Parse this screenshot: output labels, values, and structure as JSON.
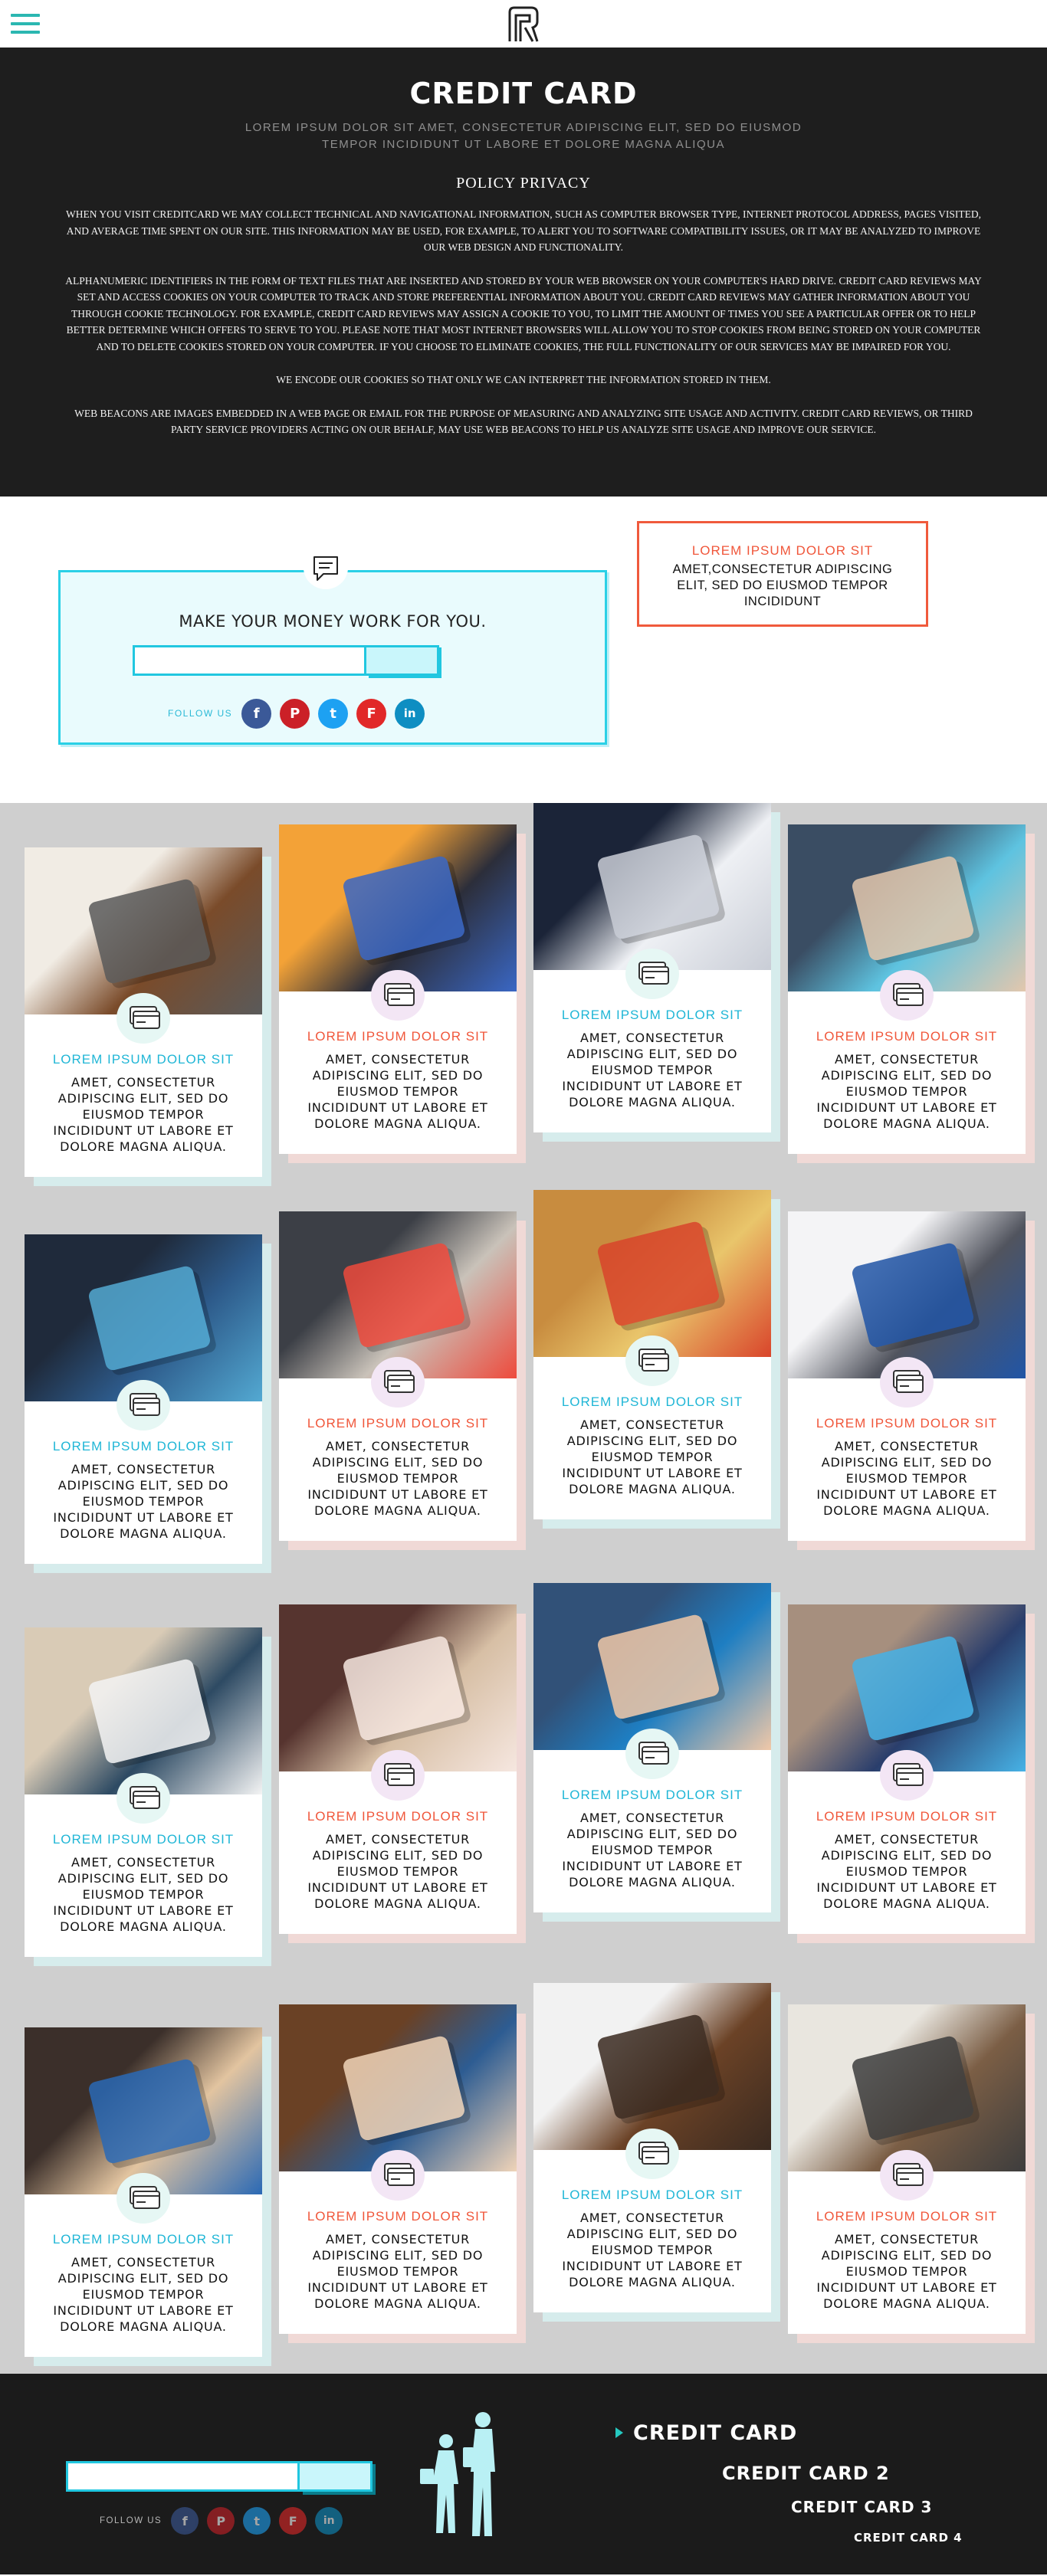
{
  "header": {
    "menu_icon": "hamburger-menu-icon",
    "logo_icon": "brand-logo-icon",
    "accent": "#2bb7b1"
  },
  "hero": {
    "title": "CREDIT CARD",
    "subtitle": "LOREM IPSUM DOLOR SIT AMET, CONSECTETUR ADIPISCING ELIT, SED DO EIUSMOD TEMPOR INCIDIDUNT UT LABORE ET DOLORE MAGNA ALIQUA",
    "policy_title": "POLICY PRIVACY",
    "paragraphs": [
      "WHEN YOU VISIT CREDITCARD WE MAY COLLECT TECHNICAL AND NAVIGATIONAL INFORMATION, SUCH AS COMPUTER BROWSER TYPE, INTERNET PROTOCOL ADDRESS, PAGES VISITED, AND AVERAGE TIME SPENT ON OUR SITE. THIS INFORMATION MAY BE USED, FOR EXAMPLE, TO ALERT YOU TO SOFTWARE COMPATIBILITY ISSUES, OR IT MAY BE ANALYZED TO IMPROVE OUR WEB DESIGN AND FUNCTIONALITY.",
      "ALPHANUMERIC IDENTIFIERS IN THE FORM OF TEXT FILES THAT ARE INSERTED AND STORED BY YOUR WEB BROWSER ON YOUR COMPUTER'S HARD DRIVE. CREDIT CARD REVIEWS MAY SET AND ACCESS COOKIES ON YOUR COMPUTER TO TRACK AND STORE PREFERENTIAL INFORMATION ABOUT YOU. CREDIT CARD REVIEWS MAY GATHER INFORMATION ABOUT YOU THROUGH COOKIE TECHNOLOGY. FOR EXAMPLE, CREDIT CARD REVIEWS MAY ASSIGN A COOKIE TO YOU, TO LIMIT THE AMOUNT OF TIMES YOU SEE A PARTICULAR OFFER OR TO HELP BETTER DETERMINE WHICH OFFERS TO SERVE TO YOU. PLEASE NOTE THAT MOST INTERNET BROWSERS WILL ALLOW YOU TO STOP COOKIES FROM BEING STORED ON YOUR COMPUTER AND TO DELETE COOKIES STORED ON YOUR COMPUTER. IF YOU CHOOSE TO ELIMINATE COOKIES, THE FULL FUNCTIONALITY OF OUR SERVICES MAY BE IMPAIRED FOR YOU.",
      "WE ENCODE OUR COOKIES SO THAT ONLY WE CAN INTERPRET THE INFORMATION STORED IN THEM.",
      "WEB BEACONS ARE IMAGES EMBEDDED IN A WEB PAGE OR EMAIL FOR THE PURPOSE OF MEASURING AND ANALYZING SITE USAGE AND ACTIVITY. CREDIT CARD REVIEWS, OR THIRD PARTY SERVICE PROVIDERS ACTING ON OUR BEHALF, MAY USE WEB BEACONS TO HELP US ANALYZE SITE USAGE AND IMPROVE OUR SERVICE."
    ]
  },
  "subscribe": {
    "icon": "chat-bubble-icon",
    "heading": "MAKE YOUR MONEY WORK FOR YOU.",
    "input_value": "",
    "button_label": "",
    "follow_label": "FOLLOW US",
    "social": [
      {
        "icon": "facebook-icon",
        "glyph": "f",
        "color": "#3b5998"
      },
      {
        "icon": "pinterest-icon",
        "glyph": "P",
        "color": "#cb2027"
      },
      {
        "icon": "twitter-icon",
        "glyph": "t",
        "color": "#1da1f2"
      },
      {
        "icon": "flipboard-icon",
        "glyph": "F",
        "color": "#e12828"
      },
      {
        "icon": "linkedin-icon",
        "glyph": "in",
        "color": "#0e8ec2"
      }
    ]
  },
  "note": {
    "title": "LOREM IPSUM DOLOR SIT",
    "body": "AMET,CONSECTETUR ADIPISCING ELIT, SED DO EIUSMOD TEMPOR INCIDIDUNT",
    "accent": "#f05a3c"
  },
  "cards": [
    {
      "photo": "wallet-in-clamp-photo",
      "title": "LOREM IPSUM DOLOR SIT",
      "text": "AMET, CONSECTETUR ADIPISCING ELIT, SED DO EIUSMOD TEMPOR INCIDIDUNT UT LABORE ET DOLORE MAGNA ALIQUA.",
      "theme": "teal"
    },
    {
      "photo": "calculator-coins-photo",
      "title": "LOREM IPSUM DOLOR SIT",
      "text": "AMET, CONSECTETUR ADIPISCING ELIT, SED DO EIUSMOD TEMPOR INCIDIDUNT UT LABORE ET DOLORE MAGNA ALIQUA.",
      "theme": "coral"
    },
    {
      "photo": "phone-earbuds-card-photo",
      "title": "LOREM IPSUM DOLOR SIT",
      "text": "AMET, CONSECTETUR ADIPISCING ELIT, SED DO EIUSMOD TEMPOR INCIDIDUNT UT LABORE ET DOLORE MAGNA ALIQUA.",
      "theme": "teal"
    },
    {
      "photo": "hand-holding-card-photo",
      "title": "LOREM IPSUM DOLOR SIT",
      "text": "AMET, CONSECTETUR ADIPISCING ELIT, SED DO EIUSMOD TEMPOR INCIDIDUNT UT LABORE ET DOLORE MAGNA ALIQUA.",
      "theme": "coral"
    },
    {
      "photo": "jeans-pocket-card-photo",
      "title": "LOREM IPSUM DOLOR SIT",
      "text": "AMET, CONSECTETUR ADIPISCING ELIT, SED DO EIUSMOD TEMPOR INCIDIDUNT UT LABORE ET DOLORE MAGNA ALIQUA.",
      "theme": "teal"
    },
    {
      "photo": "laptop-card-payment-photo",
      "title": "LOREM IPSUM DOLOR SIT",
      "text": "AMET, CONSECTETUR ADIPISCING ELIT, SED DO EIUSMOD TEMPOR INCIDIDUNT UT LABORE ET DOLORE MAGNA ALIQUA.",
      "theme": "coral"
    },
    {
      "photo": "visa-mastercard-closeup-photo",
      "title": "LOREM IPSUM DOLOR SIT",
      "text": "AMET, CONSECTETUR ADIPISCING ELIT, SED DO EIUSMOD TEMPOR INCIDIDUNT UT LABORE ET DOLORE MAGNA ALIQUA.",
      "theme": "teal"
    },
    {
      "photo": "stack-of-cards-photo",
      "title": "LOREM IPSUM DOLOR SIT",
      "text": "AMET, CONSECTETUR ADIPISCING ELIT, SED DO EIUSMOD TEMPOR INCIDIDUNT UT LABORE ET DOLORE MAGNA ALIQUA.",
      "theme": "coral"
    },
    {
      "photo": "desk-coffee-keyboard-photo",
      "title": "LOREM IPSUM DOLOR SIT",
      "text": "AMET, CONSECTETUR ADIPISCING ELIT, SED DO EIUSMOD TEMPOR INCIDIDUNT UT LABORE ET DOLORE MAGNA ALIQUA.",
      "theme": "teal"
    },
    {
      "photo": "woman-shopping-online-photo",
      "title": "LOREM IPSUM DOLOR SIT",
      "text": "AMET, CONSECTETUR ADIPISCING ELIT, SED DO EIUSMOD TEMPOR INCIDIDUNT UT LABORE ET DOLORE MAGNA ALIQUA.",
      "theme": "coral"
    },
    {
      "photo": "cash-card-wallet-photo",
      "title": "LOREM IPSUM DOLOR SIT",
      "text": "AMET, CONSECTETUR ADIPISCING ELIT, SED DO EIUSMOD TEMPOR INCIDIDUNT UT LABORE ET DOLORE MAGNA ALIQUA.",
      "theme": "teal"
    },
    {
      "photo": "card-terminal-photo",
      "title": "LOREM IPSUM DOLOR SIT",
      "text": "AMET, CONSECTETUR ADIPISCING ELIT, SED DO EIUSMOD TEMPOR INCIDIDUNT UT LABORE ET DOLORE MAGNA ALIQUA.",
      "theme": "coral"
    },
    {
      "photo": "handing-card-restaurant-photo",
      "title": "LOREM IPSUM DOLOR SIT",
      "text": "AMET, CONSECTETUR ADIPISCING ELIT, SED DO EIUSMOD TEMPOR INCIDIDUNT UT LABORE ET DOLORE MAGNA ALIQUA.",
      "theme": "teal"
    },
    {
      "photo": "passing-card-photo",
      "title": "LOREM IPSUM DOLOR SIT",
      "text": "AMET, CONSECTETUR ADIPISCING ELIT, SED DO EIUSMOD TEMPOR INCIDIDUNT UT LABORE ET DOLORE MAGNA ALIQUA.",
      "theme": "coral"
    },
    {
      "photo": "wallet-coffee-beans-photo",
      "title": "LOREM IPSUM DOLOR SIT",
      "text": "AMET, CONSECTETUR ADIPISCING ELIT, SED DO EIUSMOD TEMPOR INCIDIDUNT UT LABORE ET DOLORE MAGNA ALIQUA.",
      "theme": "teal"
    },
    {
      "photo": "wallet-back-pocket-photo",
      "title": "LOREM IPSUM DOLOR SIT",
      "text": "AMET, CONSECTETUR ADIPISCING ELIT, SED DO EIUSMOD TEMPOR INCIDIDUNT UT LABORE ET DOLORE MAGNA ALIQUA.",
      "theme": "coral"
    }
  ],
  "themes": {
    "teal": {
      "title_color": "#1fb6d6",
      "shadow": "#d6ecec",
      "badge": "#e6f7f4"
    },
    "coral": {
      "title_color": "#f0563a",
      "shadow": "#f0d9d6",
      "badge": "#f3e6f5"
    }
  },
  "footer": {
    "input_value": "",
    "button_label": "",
    "follow_label": "FOLLOW US",
    "figure_icon": "walking-businesspeople-icon",
    "links": [
      "CREDIT CARD",
      "CREDIT CARD 2",
      "CREDIT CARD 3",
      "CREDIT CARD 4"
    ]
  }
}
